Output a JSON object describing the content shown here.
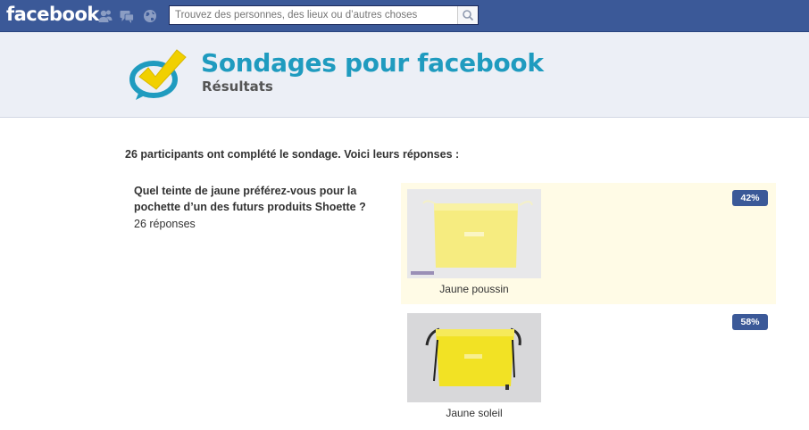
{
  "topbar": {
    "logo": "facebook",
    "search_placeholder": "Trouvez des personnes, des lieux ou d’autres choses",
    "icons": [
      "friend-requests-icon",
      "messages-icon",
      "notifications-globe-icon",
      "search-icon"
    ]
  },
  "app": {
    "title": "Sondages pour facebook",
    "subtitle": "Résultats",
    "brand_color": "#1f9bbf",
    "logo_icon": "checkmark-speech-bubble-icon"
  },
  "results": {
    "summary": "26 participants ont complété le sondage. Voici leurs réponses :",
    "question": "Quel teinte de jaune préférez-vous pour la pochette d’un des futurs produits Shoette ?",
    "response_count": "26 réponses",
    "answers": [
      {
        "label": "Jaune poussin",
        "percent": "42%",
        "highlighted": true,
        "pouch_color": "#f6ec80"
      },
      {
        "label": "Jaune soleil",
        "percent": "58%",
        "highlighted": false,
        "pouch_color": "#f2e224"
      }
    ]
  },
  "colors": {
    "fb_blue": "#3b5998",
    "header_bg": "#eceff6",
    "highlight_bg": "#fffbe6"
  }
}
